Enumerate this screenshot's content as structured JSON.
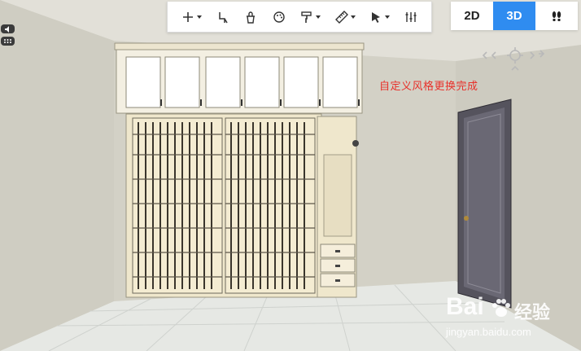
{
  "toolbar": {
    "items": [
      {
        "name": "add",
        "icon": "plus-icon",
        "has_caret": true
      },
      {
        "name": "draw-wall",
        "icon": "wall-tool-icon",
        "has_caret": false
      },
      {
        "name": "material",
        "icon": "bucket-icon",
        "has_caret": false
      },
      {
        "name": "palette",
        "icon": "palette-icon",
        "has_caret": false
      },
      {
        "name": "paint",
        "icon": "paint-roller-icon",
        "has_caret": true
      },
      {
        "name": "measure",
        "icon": "ruler-icon",
        "has_caret": true
      },
      {
        "name": "select",
        "icon": "cursor-icon",
        "has_caret": true
      },
      {
        "name": "adjust",
        "icon": "sliders-icon",
        "has_caret": false
      }
    ]
  },
  "view_toggle": {
    "options": [
      "2D",
      "3D"
    ],
    "active": "3D",
    "extra_icon": "walk-footprints-icon"
  },
  "notification": {
    "text": "自定义风格更换完成",
    "color": "#e8302a"
  },
  "watermark": {
    "brand": "Bai",
    "brand_suffix": "经验",
    "url": "jingyan.baidu.com"
  },
  "colors": {
    "accent": "#2f8cf0",
    "wall": "#d8d6cc",
    "floor": "#e4e6e2",
    "cabinet": "#f2ecd8",
    "door": "#4a4852"
  }
}
